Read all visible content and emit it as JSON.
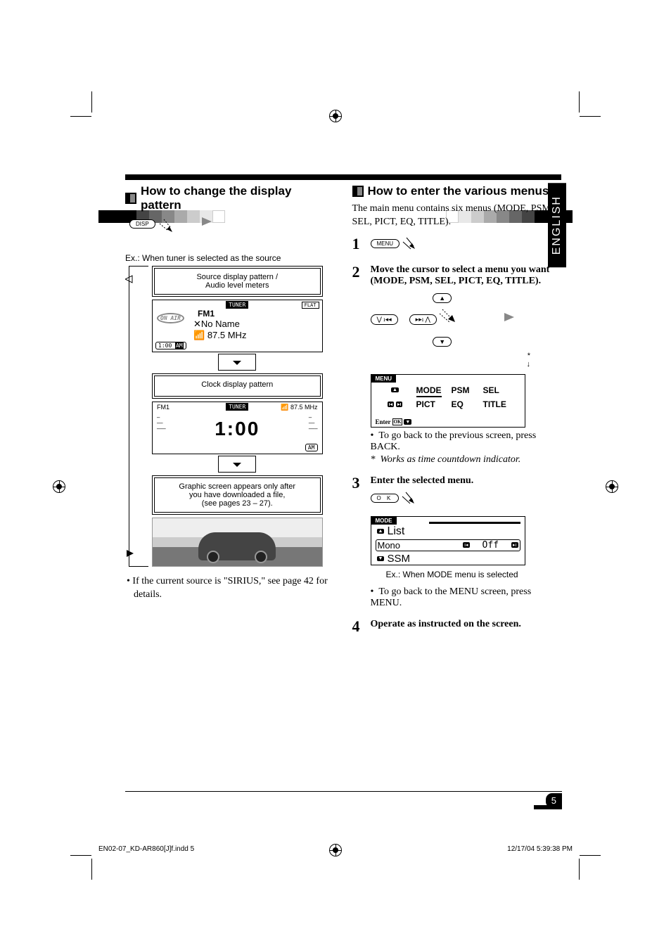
{
  "crop_colors_left": [
    "#000",
    "#000",
    "#000",
    "#333",
    "#555",
    "#888",
    "#aaa",
    "#ccc",
    "#eee",
    "#fff",
    "#fff"
  ],
  "crop_colors_right": [
    "#000",
    "#000",
    "#000",
    "#333",
    "#555",
    "#888",
    "#aaa",
    "#ccc",
    "#eee",
    "#fff",
    "#fff"
  ],
  "left": {
    "title": "How to change the display pattern",
    "disp_button": "DISP",
    "example_caption": "Ex.: When tuner is selected as the source",
    "box1": "Source display pattern /\nAudio level meters",
    "lcd1": {
      "top_label": "TUNER",
      "badge": "FLAT",
      "line1": "FM1",
      "line2": "No Name",
      "line3": "87.5 MHz",
      "onair": "ON AIR",
      "time": "1:00",
      "ampm": "AM"
    },
    "box2": "Clock display pattern",
    "lcd2": {
      "band": "FM1",
      "top_label": "TUNER",
      "freq": "87.5 MHz",
      "clock": "1:00",
      "ampm": "AM"
    },
    "box3_l1": "Graphic screen appears only after",
    "box3_l2": "you have downloaded a file,",
    "box3_l3": "(see pages 23 – 27).",
    "sirius_note": "If the current source is \"SIRIUS,\" see page 42 for details."
  },
  "right": {
    "title": "How to enter the various menus",
    "intro": "The main menu contains six menus (MODE, PSM, SEL, PICT, EQ, TITLE).",
    "english_tab": "ENGLISH",
    "menu_button": "MENU",
    "step2": "Move the cursor to select a menu you want (MODE, PSM, SEL, PICT, EQ, TITLE).",
    "asterisk": "*",
    "menu_tab": "MENU",
    "menu_items": [
      "MODE",
      "PSM",
      "SEL",
      "PICT",
      "EQ",
      "TITLE"
    ],
    "enter_label": "Enter",
    "ok_label": "OK",
    "back_note": "To go back to the previous screen, press BACK.",
    "countdown_note": "Works as time countdown indicator",
    "step3": "Enter the selected menu.",
    "ok_button": "O K",
    "mode_tab": "MODE",
    "mode_list": "List",
    "mode_mono": "Mono",
    "mode_off": "Off",
    "mode_ssm": "SSM",
    "mode_example": "Ex.: When MODE menu is selected",
    "menu_back_note": "To go back to the MENU screen, press MENU.",
    "step4": "Operate as instructed on the screen."
  },
  "page_number": "5",
  "footer": {
    "file": "EN02-07_KD-AR860[J]f.indd   5",
    "timestamp": "12/17/04   5:39:38 PM"
  }
}
